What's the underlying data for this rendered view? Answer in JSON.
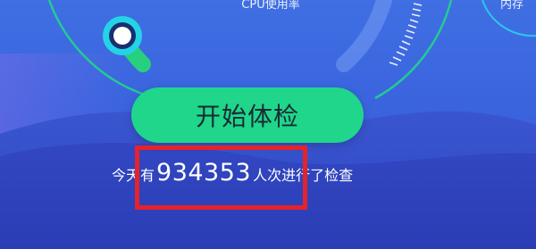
{
  "gauges": {
    "cpu_label": "CPU使用率",
    "right_label": "内存"
  },
  "start_button": {
    "label": "开始体检"
  },
  "stats": {
    "prefix": "今天有",
    "count": "934353",
    "suffix": "人次进行了检查"
  },
  "colors": {
    "background": "#3d66e0",
    "accent_green": "#1fd68b",
    "highlight_red": "#e5232a"
  }
}
